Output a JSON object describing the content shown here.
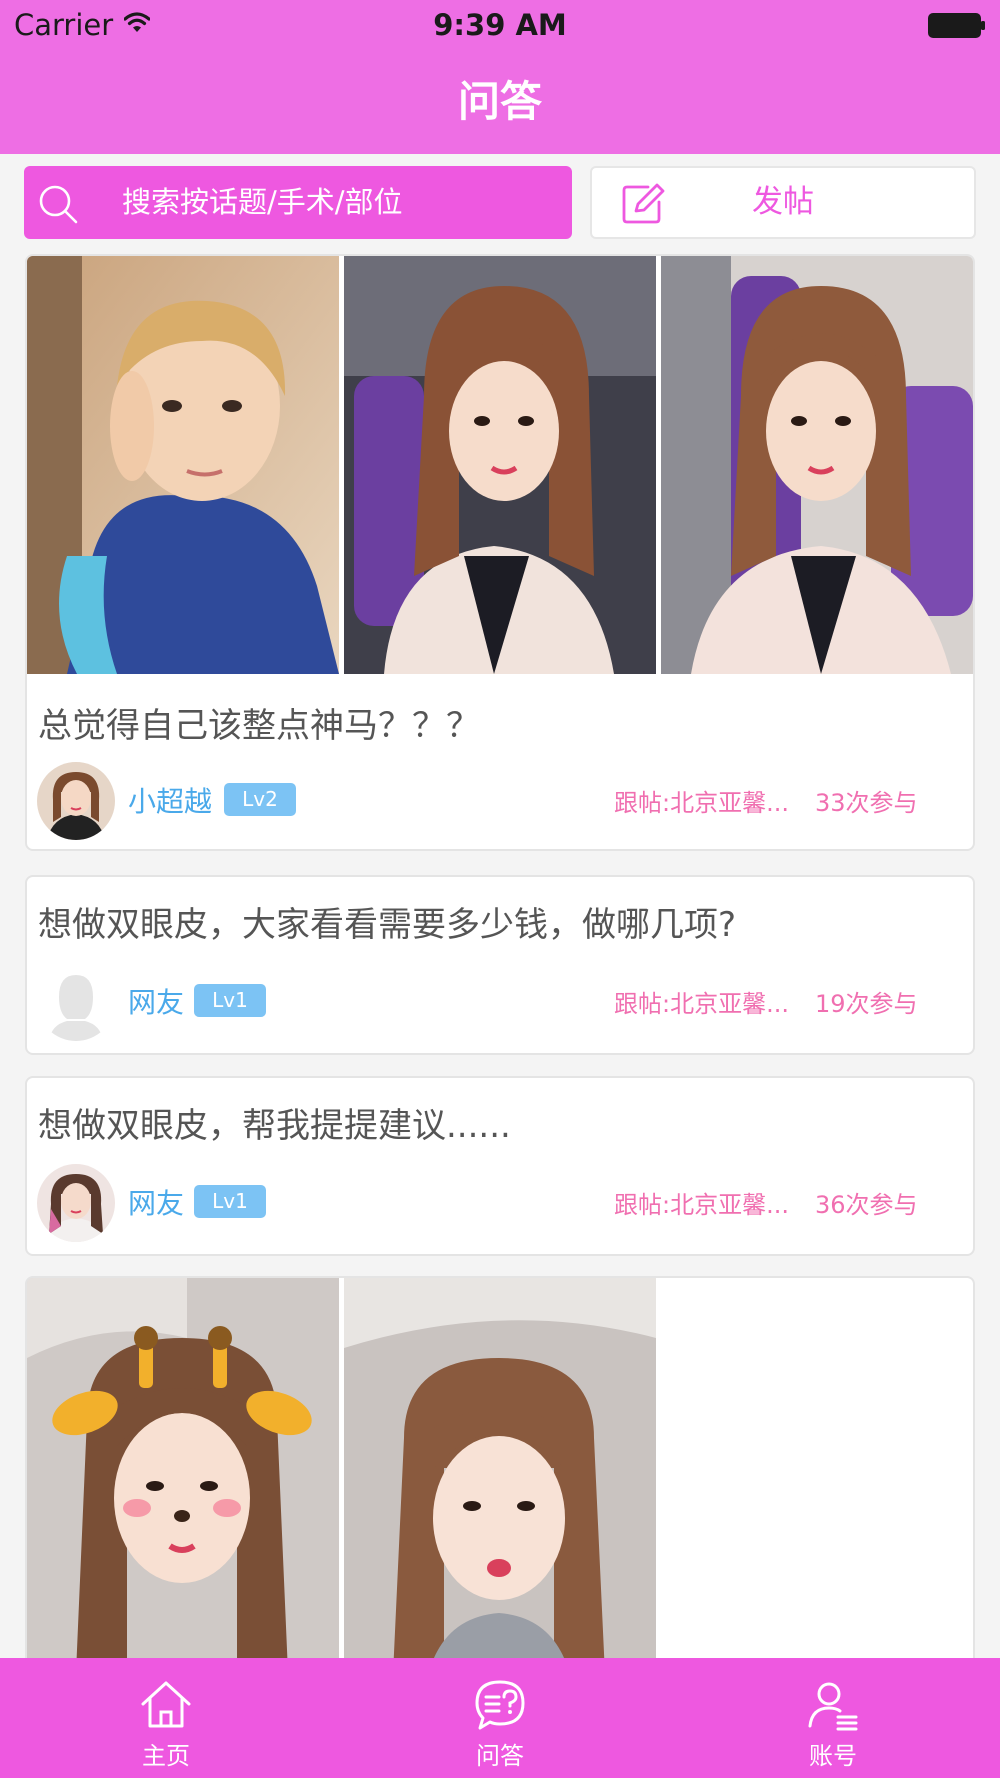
{
  "colors": {
    "accent": "#ee6ee4",
    "accent_dark": "#ee58e0",
    "link_blue": "#4aa9ea",
    "badge_blue": "#7cc3f4",
    "meta_pink": "#f06fb0"
  },
  "status_bar": {
    "carrier": "Carrier",
    "time": "9:39 AM"
  },
  "nav": {
    "title": "问答"
  },
  "search": {
    "placeholder": "搜索按话题/手术/部位"
  },
  "post_button": {
    "label": "发帖"
  },
  "posts": [
    {
      "title": "总觉得自己该整点神马？？？",
      "author": "小超越",
      "level": "Lv2",
      "reply": "跟帖:北京亚馨...",
      "participants": "33次参与",
      "photo_count": 3
    },
    {
      "title": "想做双眼皮，大家看看需要多少钱，做哪几项?",
      "author": "网友",
      "level": "Lv1",
      "reply": "跟帖:北京亚馨...",
      "participants": "19次参与",
      "photo_count": 0
    },
    {
      "title": "想做双眼皮，帮我提提建议......",
      "author": "网友",
      "level": "Lv1",
      "reply": "跟帖:北京亚馨...",
      "participants": "36次参与",
      "photo_count": 0
    },
    {
      "title": "",
      "author": "",
      "level": "",
      "reply": "",
      "participants": "",
      "photo_count": 2
    }
  ],
  "tabs": [
    {
      "label": "主页",
      "icon": "home-icon"
    },
    {
      "label": "问答",
      "icon": "chat-question-icon"
    },
    {
      "label": "账号",
      "icon": "user-list-icon"
    }
  ]
}
